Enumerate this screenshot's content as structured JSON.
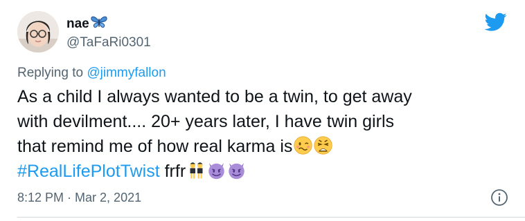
{
  "user": {
    "display_name": "nae",
    "handle": "@TaFaRi0301",
    "name_emoji": "butterfly-icon"
  },
  "reply": {
    "prefix": "Replying to ",
    "to_handle": "@jimmyfallon"
  },
  "tweet": {
    "line1": "As a child I always wanted to be a twin, to get away",
    "line2": "with devilment.... 20+ years later, I have twin girls",
    "line3": "that remind me of how real karma is",
    "hashtag": "#RealLifePlotTwist",
    "suffix": " frfr",
    "emojis": [
      "woozy-face-icon",
      "weary-face-icon",
      "twin-girls-icon",
      "smiling-devil-icon",
      "smiling-devil-icon"
    ]
  },
  "timestamp": {
    "time": "8:12 PM",
    "separator": " · ",
    "date": "Mar 2, 2021"
  },
  "colors": {
    "link_blue": "#1d9bf0",
    "secondary_text": "#536471",
    "primary_text": "#0f1419"
  },
  "icons": {
    "brand": "twitter-bird-icon",
    "info": "info-icon"
  }
}
